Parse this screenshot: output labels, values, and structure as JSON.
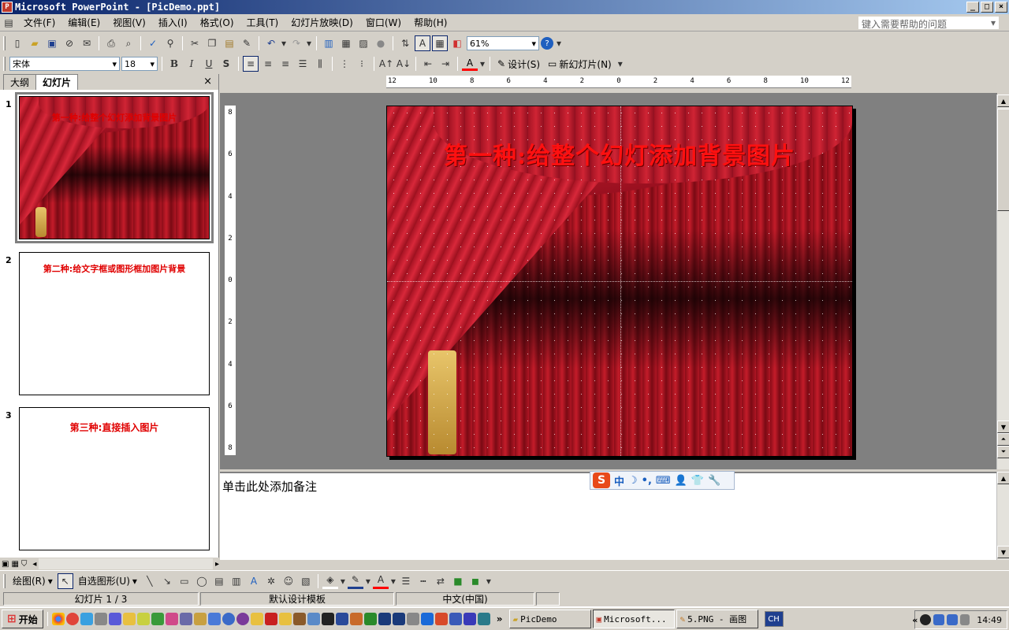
{
  "window": {
    "title": "Microsoft PowerPoint - [PicDemo.ppt]",
    "buttons": {
      "minimize": "_",
      "maximize": "□",
      "close": "×"
    }
  },
  "menu": {
    "items": [
      "文件(F)",
      "编辑(E)",
      "视图(V)",
      "插入(I)",
      "格式(O)",
      "工具(T)",
      "幻灯片放映(D)",
      "窗口(W)",
      "帮助(H)"
    ],
    "help_placeholder": "键入需要帮助的问题"
  },
  "standard_toolbar": {
    "zoom": "61%"
  },
  "format_toolbar": {
    "font": "宋体",
    "font_size": "18",
    "bold": "B",
    "italic": "I",
    "underline": "U",
    "shadow": "S",
    "font_color_letter": "A",
    "design_label": "设计(S)",
    "new_slide_label": "新幻灯片(N)"
  },
  "left_pane": {
    "tabs": [
      "大纲",
      "幻灯片"
    ],
    "selected_tab": "幻灯片",
    "close": "×",
    "slides": [
      {
        "number": "1",
        "title": "第一种:给整个幻灯添加背景图片",
        "has_background": true
      },
      {
        "number": "2",
        "title": "第二种:给文字框或图形框加图片背景",
        "has_background": false
      },
      {
        "number": "3",
        "title": "第三种:直接插入图片",
        "has_background": false
      }
    ]
  },
  "ruler": {
    "horizontal": [
      "12",
      "10",
      "8",
      "6",
      "4",
      "2",
      "0",
      "2",
      "4",
      "6",
      "8",
      "10",
      "12"
    ],
    "vertical": [
      "8",
      "6",
      "4",
      "2",
      "0",
      "2",
      "4",
      "6",
      "8"
    ]
  },
  "slide": {
    "title": "第一种:给整个幻灯添加背景图片"
  },
  "notes": {
    "placeholder": "单击此处添加备注"
  },
  "ime_bar": {
    "logo": "S",
    "mode": "中",
    "moon": "☽",
    "punct": "•,",
    "keyboard": "⌨",
    "user": "👤",
    "skin": "👕",
    "tools": "🔧"
  },
  "draw_toolbar": {
    "draw_label": "绘图(R)",
    "autoshapes_label": "自选图形(U)"
  },
  "status_bar": {
    "slide_info": "幻灯片 1 / 3",
    "template": "默认设计模板",
    "language": "中文(中国)"
  },
  "taskbar": {
    "start": "开始",
    "tasks": [
      {
        "label": "PicDemo",
        "pressed": false
      },
      {
        "label": "Microsoft...",
        "pressed": true
      },
      {
        "label": "5.PNG - 画图",
        "pressed": false
      }
    ],
    "lang_indicator": "CH",
    "tray_expand": "«",
    "clock": "14:49",
    "more": "»"
  },
  "colors": {
    "title_red": "#ff1010",
    "titlebar_start": "#0a246a",
    "titlebar_end": "#a6caf0"
  }
}
